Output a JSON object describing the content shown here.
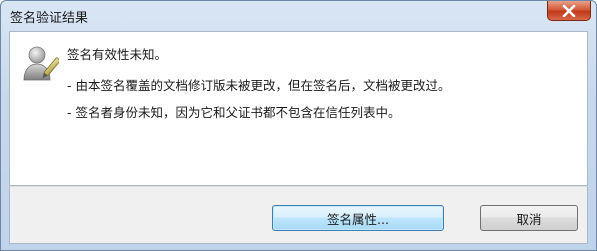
{
  "dialog": {
    "title": "签名验证结果",
    "close_icon": "close-icon",
    "user_icon": "signer-unknown-user-icon",
    "message_main": "签名有效性未知。",
    "messages": [
      "- 由本签名覆盖的文档修订版未被更改，但在签名后，文档被更改过。",
      "- 签名者身份未知，因为它和父证书都不包含在信任列表中。"
    ],
    "buttons": {
      "properties": "签名属性...",
      "cancel": "取消"
    }
  }
}
